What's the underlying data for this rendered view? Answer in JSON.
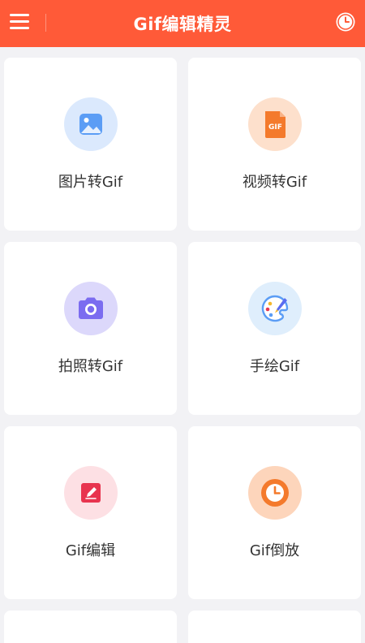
{
  "app": {
    "title": "Gif编辑精灵"
  },
  "appbar": {
    "menu_icon": "menu-icon",
    "history_icon": "clock-icon",
    "background_color": "#ff5a38"
  },
  "features": [
    {
      "label": "图片转Gif",
      "icon": "image-icon",
      "color": "#5b9df5"
    },
    {
      "label": "视频转Gif",
      "icon": "gif-file-icon",
      "color": "#f47a2c"
    },
    {
      "label": "拍照转Gif",
      "icon": "camera-icon",
      "color": "#7b6cf0"
    },
    {
      "label": "手绘Gif",
      "icon": "paint-palette-icon",
      "color": "#5b9df5"
    },
    {
      "label": "Gif编辑",
      "icon": "edit-icon",
      "color": "#e8344f"
    },
    {
      "label": "Gif倒放",
      "icon": "clock-reverse-icon",
      "color": "#f47a2c"
    }
  ]
}
